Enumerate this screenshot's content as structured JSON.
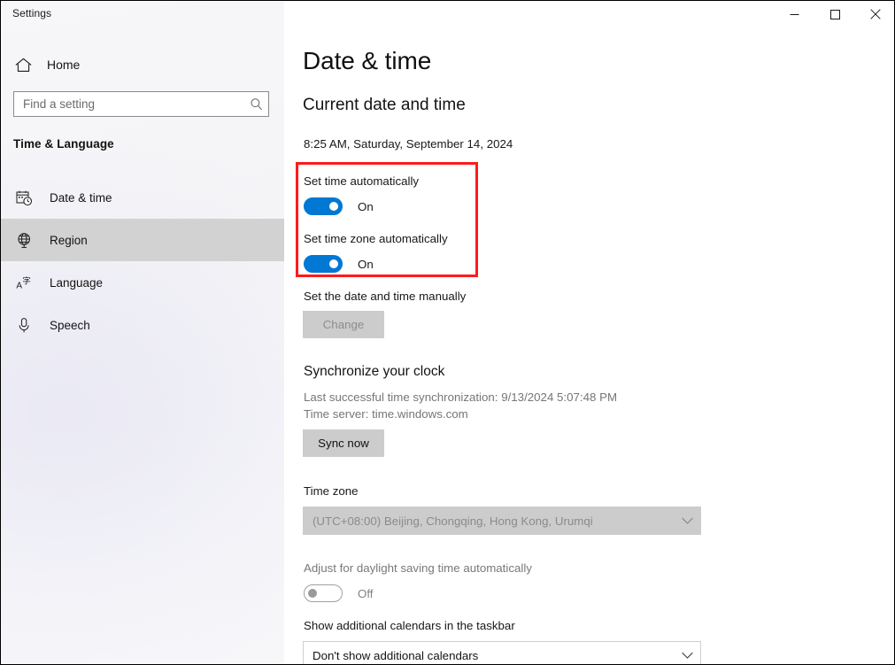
{
  "window": {
    "title": "Settings",
    "controls": {
      "minimize": "Minimize",
      "maximize": "Maximize",
      "close": "Close"
    }
  },
  "sidebar": {
    "home_label": "Home",
    "home_icon": "home-icon",
    "search": {
      "placeholder": "Find a setting",
      "value": "",
      "icon": "search-icon"
    },
    "group_title": "Time & Language",
    "items": [
      {
        "label": "Date & time",
        "icon": "calendar-clock-icon",
        "selected": false
      },
      {
        "label": "Region",
        "icon": "globe-icon",
        "selected": true
      },
      {
        "label": "Language",
        "icon": "language-icon",
        "selected": false
      },
      {
        "label": "Speech",
        "icon": "microphone-icon",
        "selected": false
      }
    ]
  },
  "main": {
    "page_title": "Date & time",
    "current": {
      "heading": "Current date and time",
      "value": "8:25 AM, Saturday, September 14, 2024"
    },
    "set_time_auto": {
      "label": "Set time automatically",
      "state": "On",
      "enabled": true
    },
    "set_timezone_auto": {
      "label": "Set time zone automatically",
      "state": "On",
      "enabled": true
    },
    "manual": {
      "label": "Set the date and time manually",
      "button": "Change",
      "button_disabled": true
    },
    "sync": {
      "heading": "Synchronize your clock",
      "last_sync": "Last successful time synchronization: 9/13/2024 5:07:48 PM",
      "time_server": "Time server: time.windows.com",
      "button": "Sync now"
    },
    "timezone": {
      "label": "Time zone",
      "value": "(UTC+08:00) Beijing, Chongqing, Hong Kong, Urumqi",
      "disabled": true
    },
    "daylight": {
      "label": "Adjust for daylight saving time automatically",
      "state": "Off",
      "enabled": false
    },
    "calendars": {
      "label": "Show additional calendars in the taskbar",
      "value": "Don't show additional calendars",
      "disabled": false
    }
  },
  "annotation": {
    "color": "#ff1a1a",
    "name": "highlight-box-auto-time-settings"
  }
}
